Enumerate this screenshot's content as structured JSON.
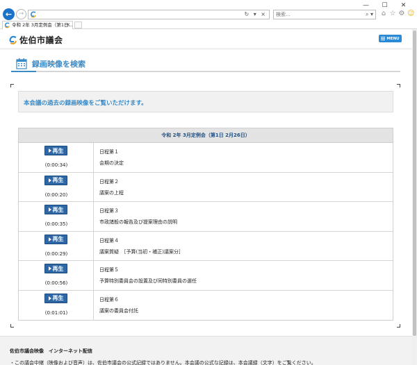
{
  "browser": {
    "window_controls": [
      "—",
      "☐",
      "✕"
    ],
    "address_controls": "↻ ▾ ×",
    "search_placeholder": "検索...",
    "search_controls": "⌕ ▾",
    "tab_label": "令和 2年 3月定例会（第1日...",
    "tab_close": "✕"
  },
  "site": {
    "logo_text": "佐伯市議会",
    "menu_label": "MENU",
    "page_title": "録画映像を検索",
    "notice": "本会議の過去の録画映像をご覧いただけます。",
    "accent_color": "#3a8ac6"
  },
  "session": {
    "title": "令和 2年 3月定例会（第1日 2月26日）",
    "play_label": "再生",
    "rows": [
      {
        "duration": "(0:00:34)",
        "agenda_no": "日程第１",
        "agenda_title": "会期の決定"
      },
      {
        "duration": "(0:00:20)",
        "agenda_no": "日程第２",
        "agenda_title": "議案の上程"
      },
      {
        "duration": "(0:00:35)",
        "agenda_no": "日程第３",
        "agenda_title": "市政諸般の報告及び提案理由の説明"
      },
      {
        "duration": "(0:00:29)",
        "agenda_no": "日程第４",
        "agenda_title": "議案質疑　［予算(当初・補正)議案分］"
      },
      {
        "duration": "(0:00:56)",
        "agenda_no": "日程第５",
        "agenda_title": "予算特別委員会の設置及び同特別委員の選任"
      },
      {
        "duration": "(0:01:01)",
        "agenda_no": "日程第６",
        "agenda_title": "議案の委員会付託"
      }
    ]
  },
  "footer": {
    "title": "佐伯市議会映像　インターネット配信",
    "note": "・この議会中継（映像および音声）は、佐伯市議会の公式記録ではありません。本会議の公式な記録は、本会議録（文字）をご覧ください。"
  }
}
